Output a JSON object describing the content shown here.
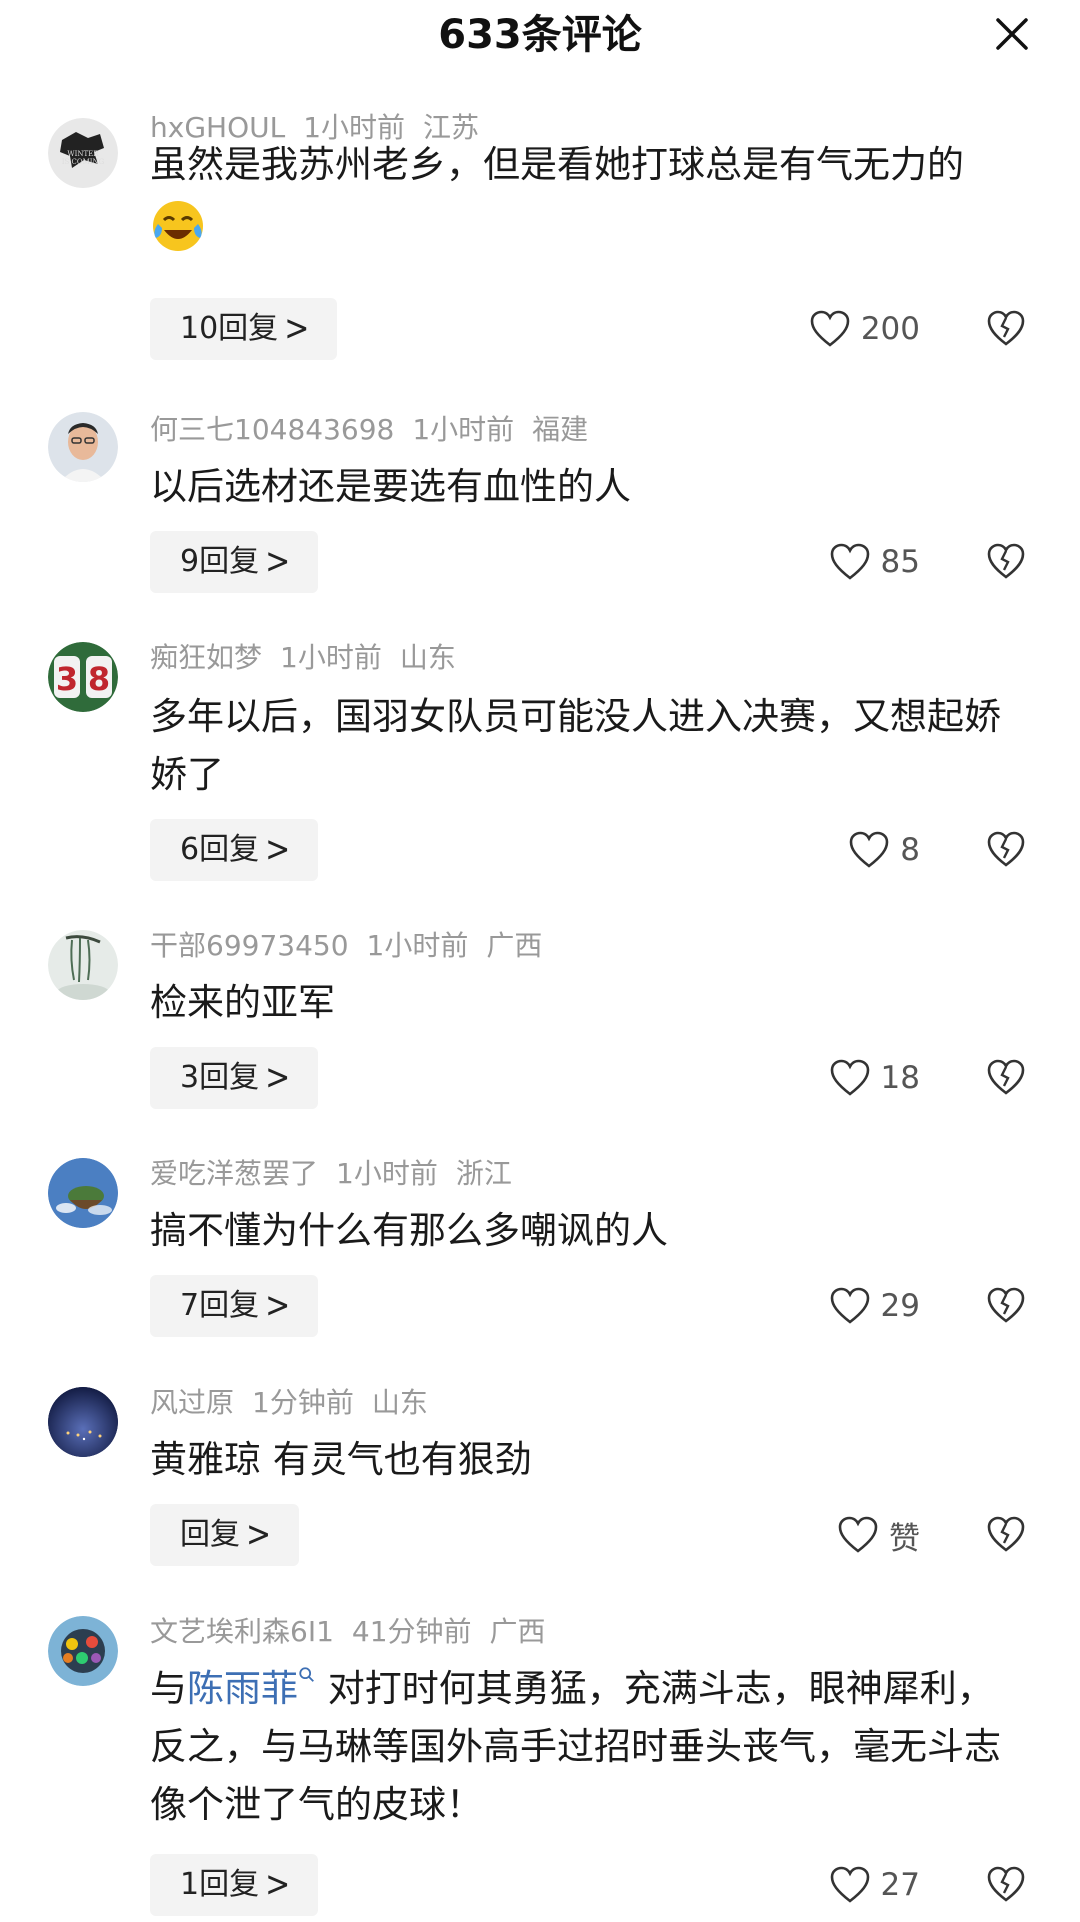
{
  "header": {
    "title": "633条评论"
  },
  "comments": [
    {
      "user": "hxGHOUL",
      "time": "1小时前",
      "region": "江苏",
      "text": "虽然是我苏州老乡，但是看她打球总是有气无力的",
      "emoji": "laughing-crying-emoji",
      "replies": "10回复",
      "likes": "200"
    },
    {
      "user": "何三七104843698",
      "time": "1小时前",
      "region": "福建",
      "text": "以后选材还是要选有血性的人",
      "replies": "9回复",
      "likes": "85"
    },
    {
      "user": "痴狂如梦",
      "time": "1小时前",
      "region": "山东",
      "text": "多年以后，国羽女队员可能没人进入决赛，又想起娇娇了",
      "replies": "6回复",
      "likes": "8"
    },
    {
      "user": "干部69973450",
      "time": "1小时前",
      "region": "广西",
      "text": "检来的亚军",
      "replies": "3回复",
      "likes": "18"
    },
    {
      "user": "爱吃洋葱罢了",
      "time": "1小时前",
      "region": "浙江",
      "text": "搞不懂为什么有那么多嘲讽的人",
      "replies": "7回复",
      "likes": "29"
    },
    {
      "user": "风过原",
      "time": "1分钟前",
      "region": "山东",
      "text": "黄雅琼 有灵气也有狠劲",
      "replies": "回复",
      "likes": "赞"
    },
    {
      "user": "文艺埃利森6I1",
      "time": "41分钟前",
      "region": "广西",
      "text_prefix": "与",
      "mention": "陈雨菲",
      "text_suffix": " 对打时何其勇猛，充满斗志，眼神犀利，反之，与马琳等国外高手过招时垂头丧气，毫无斗志像个泄了气的皮球！",
      "replies": "1回复",
      "likes": "27"
    }
  ],
  "icons": {
    "close": "close-icon",
    "like": "heart-outline-icon",
    "dislike": "broken-heart-icon",
    "chevron": "chevron-right-icon",
    "mention_search": "search-icon"
  },
  "colors": {
    "mention": "#3d6fb4",
    "meta": "#999999",
    "reply_bg": "#f3f3f3"
  }
}
